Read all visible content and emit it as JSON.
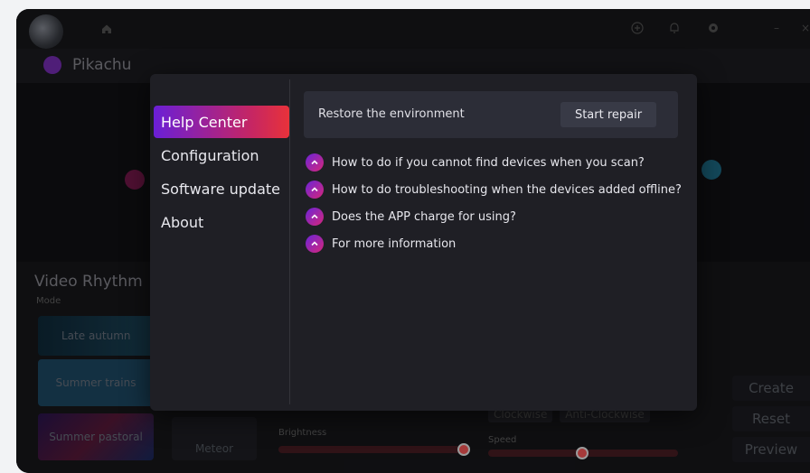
{
  "app": {
    "device_name": "Pikachu"
  },
  "titlebar": {
    "icons": [
      "avatar",
      "home-icon",
      "add-circle-icon",
      "bell-icon",
      "settings-icon",
      "minimize-icon",
      "close-icon"
    ],
    "minimize": "–",
    "close": "×"
  },
  "background": {
    "section_title": "Video Rhythm",
    "mode_label": "Mode",
    "modes": [
      "Late autumn",
      "Summer trains",
      "Summer pastoral"
    ],
    "meteor": "Meteor",
    "brightness_label": "Brightness",
    "brightness": 1.0,
    "directions": [
      "Clockwise",
      "Anti-Clockwise"
    ],
    "speed_label": "Speed",
    "speed": 0.5,
    "actions": [
      "Create",
      "Reset",
      "Preview"
    ]
  },
  "dialog": {
    "menu": [
      {
        "label": "Help Center",
        "active": true
      },
      {
        "label": "Configuration",
        "active": false
      },
      {
        "label": "Software update",
        "active": false
      },
      {
        "label": "About",
        "active": false
      }
    ],
    "repair": {
      "text": "Restore the environment",
      "button": "Start repair"
    },
    "faqs": [
      "How to do if you cannot find devices when you scan?",
      "How to do troubleshooting when the devices added offline?",
      "Does the APP charge for using?",
      "For more information"
    ]
  },
  "colors": {
    "accent_start": "#6a1fd6",
    "accent_end": "#e8323a",
    "dialog_bg": "#1f1f25"
  }
}
